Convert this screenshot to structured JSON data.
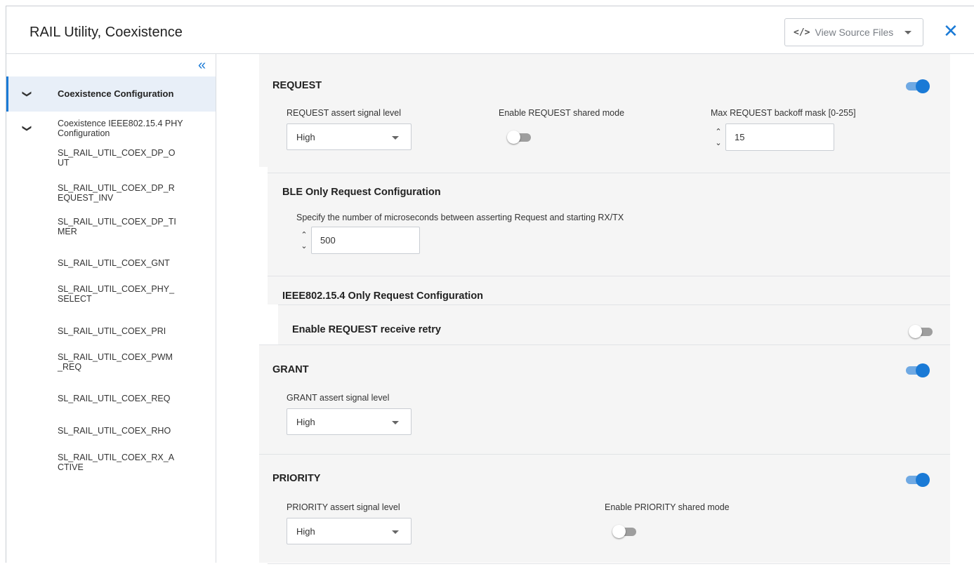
{
  "header": {
    "title": "RAIL Utility, Coexistence",
    "view_source_icon": "</>",
    "view_source_label": "View Source Files"
  },
  "colors": {
    "accent": "#1a7ad6",
    "toggle_on_track": "#6fa9e3",
    "toggle_off_track": "#9e9e9e",
    "active_nav_bg": "#e8eff8",
    "content_bg": "#f5f5f5"
  },
  "sidebar": {
    "items": [
      {
        "label": "Coexistence Configuration",
        "expandable": true,
        "active": true
      },
      {
        "label": "Coexistence IEEE802.15.4 PHY Configuration",
        "expandable": true
      },
      {
        "label": "SL_RAIL_UTIL_COEX_DP_OUT"
      },
      {
        "label": "SL_RAIL_UTIL_COEX_DP_REQUEST_INV"
      },
      {
        "label": "SL_RAIL_UTIL_COEX_DP_TIMER"
      },
      {
        "label": "SL_RAIL_UTIL_COEX_GNT"
      },
      {
        "label": "SL_RAIL_UTIL_COEX_PHY_SELECT"
      },
      {
        "label": "SL_RAIL_UTIL_COEX_PRI"
      },
      {
        "label": "SL_RAIL_UTIL_COEX_PWM_REQ"
      },
      {
        "label": "SL_RAIL_UTIL_COEX_REQ"
      },
      {
        "label": "SL_RAIL_UTIL_COEX_RHO"
      },
      {
        "label": "SL_RAIL_UTIL_COEX_RX_ACTIVE"
      }
    ]
  },
  "request": {
    "title": "REQUEST",
    "enabled": true,
    "assert_label": "REQUEST assert signal level",
    "assert_value": "High",
    "shared_label": "Enable REQUEST shared mode",
    "shared_enabled": false,
    "backoff_label": "Max REQUEST backoff mask [0-255]",
    "backoff_value": "15"
  },
  "ble": {
    "title": "BLE Only Request Configuration",
    "us_label": "Specify the number of microseconds between asserting Request and starting RX/TX",
    "us_value": "500"
  },
  "ieee": {
    "title": "IEEE802.15.4 Only Request Configuration",
    "retry_label": "Enable REQUEST receive retry",
    "retry_enabled": false
  },
  "grant": {
    "title": "GRANT",
    "enabled": true,
    "assert_label": "GRANT assert signal level",
    "assert_value": "High"
  },
  "priority": {
    "title": "PRIORITY",
    "enabled": true,
    "assert_label": "PRIORITY assert signal level",
    "assert_value": "High",
    "shared_label": "Enable PRIORITY shared mode",
    "shared_enabled": false
  }
}
